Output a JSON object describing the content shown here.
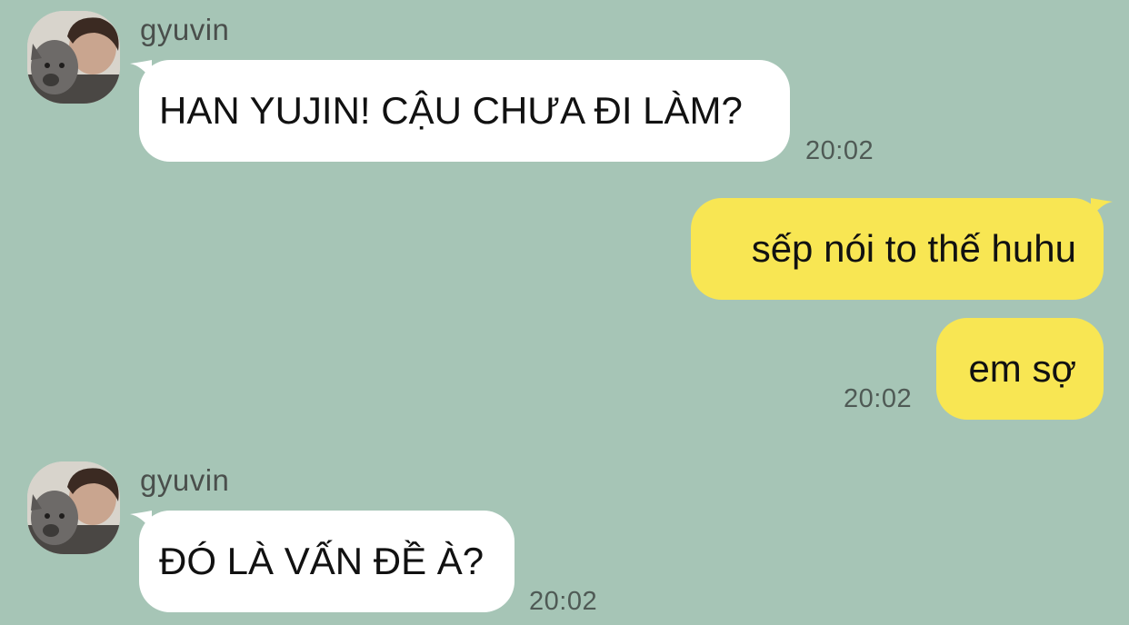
{
  "messages": [
    {
      "direction": "incoming",
      "sender": "gyuvin",
      "text": "HAN YUJIN! CẬU CHƯA ĐI LÀM?",
      "time": "20:02"
    },
    {
      "direction": "outgoing",
      "text": "sếp nói to thế huhu"
    },
    {
      "direction": "outgoing",
      "text": "em sợ",
      "time": "20:02"
    },
    {
      "direction": "incoming",
      "sender": "gyuvin",
      "text": "ĐÓ LÀ VẤN ĐỀ À?",
      "time": "20:02"
    }
  ],
  "colors": {
    "background": "#a6c5b6",
    "incoming_bubble": "#ffffff",
    "outgoing_bubble": "#f8e653",
    "timestamp": "#4f5a55"
  }
}
